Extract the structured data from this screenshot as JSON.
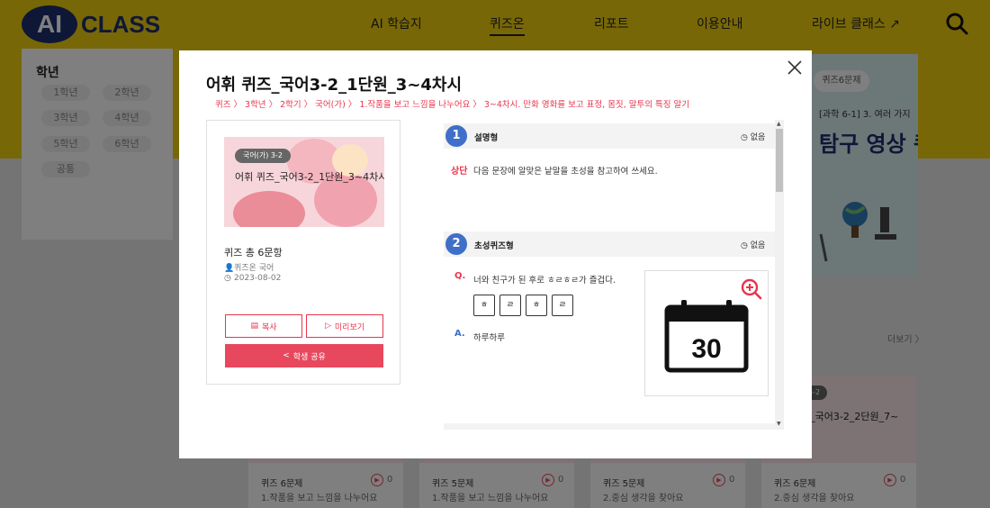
{
  "header": {
    "logo_ai": "AI",
    "logo_class": "CLASS",
    "nav": [
      "AI 학습지",
      "퀴즈온",
      "리포트",
      "이용안내",
      "라이브 클래스 ↗"
    ]
  },
  "sidebar": {
    "title": "학년",
    "grades": [
      "1학년",
      "2학년",
      "3학년",
      "4학년",
      "5학년",
      "6학년",
      "공통"
    ]
  },
  "promo": {
    "pill": "퀴즈6문제",
    "subtitle": "[과학 6-1] 3. 여러 가지",
    "title": "탐구 영상 퀴"
  },
  "more_link": "더보기 〉",
  "cards": [
    {
      "quiz": "퀴즈 6문제",
      "unit": "1.작품을 보고 느낌을 나누어요",
      "count": "0"
    },
    {
      "quiz": "퀴즈 5문제",
      "unit": "1.작품을 보고 느낌을 나누어요",
      "count": "0"
    },
    {
      "quiz": "퀴즈 5문제",
      "unit": "2.중심 생각을 찾아요",
      "count": "0"
    },
    {
      "quiz": "퀴즈 6문제",
      "unit": "2.중심 생각을 찾아요",
      "count": "0",
      "tag": "3-2",
      "title": "즈_국어3-2_2단원_7~"
    }
  ],
  "modal": {
    "title": "어휘 퀴즈_국어3-2_1단원_3~4차시",
    "breadcrumb": "퀴즈 〉 3학년 〉 2학기 〉 국어(가) 〉 1.작품을 보고 느낌을 나누어요 〉 3~4차시. 만화 영화를 보고 표정, 몸짓, 말투의 특징 알기",
    "card": {
      "tag": "국어(가) 3-2",
      "thumb_title": "어휘 퀴즈_국어3-2_1단원_3~4차시",
      "count": "퀴즈 총 6문항",
      "author": "퀴즈온 국어",
      "date": "2023-08-02",
      "copy_label": "복사",
      "preview_label": "미리보기",
      "share_label": "학생 공유"
    },
    "questions": [
      {
        "num": "1",
        "type": "설명형",
        "time": "없음",
        "level": "상단",
        "text": "다음 문장에 알맞은 낱말을 초성을 참고하여 쓰세요."
      },
      {
        "num": "2",
        "type": "초성퀴즈형",
        "time": "없음",
        "q_mark": "Q.",
        "text": "너와 친구가 된 후로 ㅎㄹㅎㄹ가 즐겁다.",
        "choices": [
          "ㅎ",
          "ㄹ",
          "ㅎ",
          "ㄹ"
        ],
        "a_mark": "A.",
        "answer": "하루하루",
        "image_label": "30"
      }
    ]
  },
  "colors": {
    "brand_yellow": "#f1cf0f",
    "brand_navy": "#1f2f6e",
    "accent_red": "#e8354c",
    "question_blue": "#3f6fc8"
  }
}
